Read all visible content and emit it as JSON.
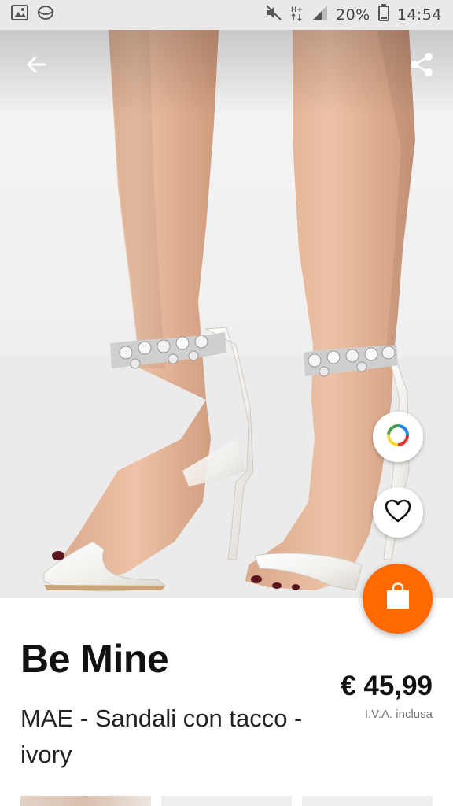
{
  "status_bar": {
    "battery_percent": "20%",
    "time": "14:54",
    "icons": [
      "gallery-icon",
      "sync-icon",
      "mute-icon",
      "network-h-plus-icon",
      "signal-icon",
      "battery-icon"
    ]
  },
  "toolbar": {
    "back_icon": "arrow-left-icon",
    "share_icon": "share-icon"
  },
  "actions": {
    "color_picker_icon": "color-wheel-icon",
    "wishlist_icon": "heart-outline-icon",
    "add_to_bag_icon": "shopping-bag-icon"
  },
  "product": {
    "brand": "Be Mine",
    "name": "MAE - Sandali con tacco - ivory",
    "price": "€ 45,99",
    "vat_note": "I.V.A. inclusa"
  },
  "colors": {
    "accent": "#ff6900",
    "status_bar_bg": "#e9e9e9"
  },
  "thumbnails_count": 3
}
